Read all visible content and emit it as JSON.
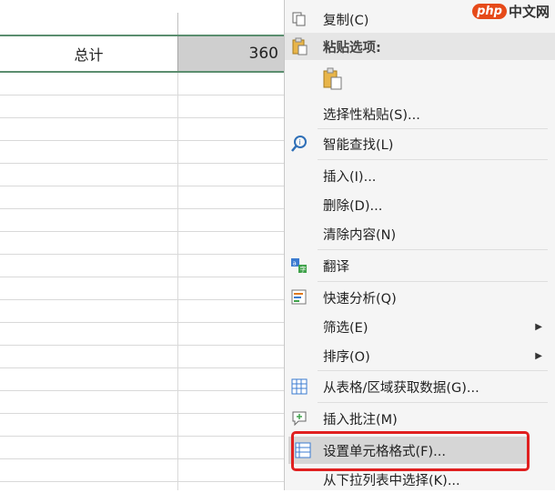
{
  "spreadsheet": {
    "total_row": {
      "label": "总计",
      "value": "360"
    }
  },
  "watermark": {
    "logo": "php",
    "text": "中文网"
  },
  "context_menu": {
    "items": [
      {
        "label": "复制(C)",
        "icon": "copy-icon"
      },
      {
        "label": "粘贴选项:",
        "icon": "paste-icon"
      },
      {
        "label": "选择性粘贴(S)...",
        "icon": ""
      },
      {
        "label": "智能查找(L)",
        "icon": "smart-lookup-icon"
      },
      {
        "label": "插入(I)...",
        "icon": ""
      },
      {
        "label": "删除(D)...",
        "icon": ""
      },
      {
        "label": "清除内容(N)",
        "icon": ""
      },
      {
        "label": "翻译",
        "icon": "translate-icon"
      },
      {
        "label": "快速分析(Q)",
        "icon": "quick-analysis-icon"
      },
      {
        "label": "筛选(E)",
        "icon": "",
        "submenu": true
      },
      {
        "label": "排序(O)",
        "icon": "",
        "submenu": true
      },
      {
        "label": "从表格/区域获取数据(G)...",
        "icon": "table-icon"
      },
      {
        "label": "插入批注(M)",
        "icon": "comment-icon"
      },
      {
        "label": "设置单元格格式(F)...",
        "icon": "format-cells-icon",
        "highlighted": true
      },
      {
        "label": "从下拉列表中选择(K)...",
        "icon": ""
      }
    ],
    "submenu_arrow": "▶"
  },
  "colors": {
    "highlight_box": "#e02020",
    "total_row_rule": "#5b8e6f",
    "selected_cell": "#cfcfcf",
    "menu_bg": "#f5f5f5"
  }
}
